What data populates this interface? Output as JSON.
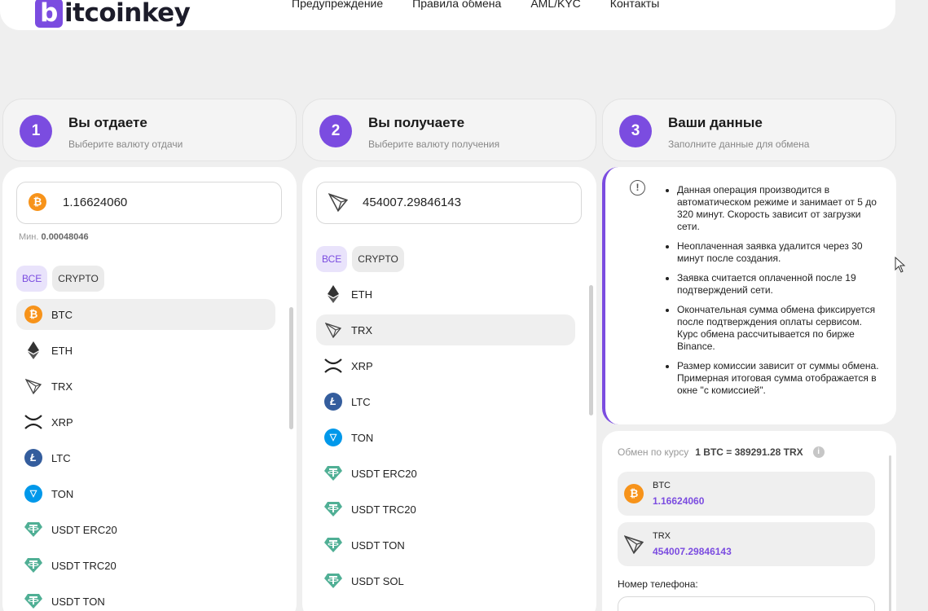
{
  "brand": {
    "logo_letter": "b",
    "logo_rest": "itcoinkey"
  },
  "nav": [
    {
      "label": "Предупреждение"
    },
    {
      "label": "Правила обмена"
    },
    {
      "label": "AML/KYC"
    },
    {
      "label": "Контакты"
    }
  ],
  "steps": [
    {
      "num": "1",
      "title": "Вы отдаете",
      "sub": "Выберите валюту отдачи"
    },
    {
      "num": "2",
      "title": "Вы получаете",
      "sub": "Выберите валюту получения"
    },
    {
      "num": "3",
      "title": "Ваши данные",
      "sub": "Заполните данные для обмена"
    }
  ],
  "give": {
    "amount": "1.16624060",
    "min_label": "Мин.",
    "min_value": "0.00048046",
    "filters": [
      "ВСЕ",
      "CRYPTO"
    ],
    "currencies": [
      {
        "label": "BTC",
        "icon": "bitcoin-icon",
        "selected": true
      },
      {
        "label": "ETH",
        "icon": "ethereum-icon"
      },
      {
        "label": "TRX",
        "icon": "tron-icon"
      },
      {
        "label": "XRP",
        "icon": "xrp-icon"
      },
      {
        "label": "LTC",
        "icon": "litecoin-icon"
      },
      {
        "label": "TON",
        "icon": "ton-icon"
      },
      {
        "label": "USDT ERC20",
        "icon": "tether-icon"
      },
      {
        "label": "USDT TRC20",
        "icon": "tether-icon"
      },
      {
        "label": "USDT TON",
        "icon": "tether-icon"
      }
    ]
  },
  "receive": {
    "amount": "454007.29846143",
    "filters": [
      "ВСЕ",
      "CRYPTO"
    ],
    "currencies": [
      {
        "label": "ETH",
        "icon": "ethereum-icon"
      },
      {
        "label": "TRX",
        "icon": "tron-icon",
        "selected": true
      },
      {
        "label": "XRP",
        "icon": "xrp-icon"
      },
      {
        "label": "LTC",
        "icon": "litecoin-icon"
      },
      {
        "label": "TON",
        "icon": "ton-icon"
      },
      {
        "label": "USDT ERC20",
        "icon": "tether-icon"
      },
      {
        "label": "USDT TRC20",
        "icon": "tether-icon"
      },
      {
        "label": "USDT TON",
        "icon": "tether-icon"
      },
      {
        "label": "USDT SOL",
        "icon": "tether-icon"
      }
    ]
  },
  "info": {
    "notes": [
      "Данная операция производится в автоматическом режиме и занимает от 5 до 320 минут. Скорость зависит от загрузки сети.",
      "Неоплаченная заявка удалится через 30 минут после создания.",
      "Заявка считается оплаченной после 19 подтверждений сети.",
      "Окончательная сумма обмена фиксируется после подтверждения оплаты сервисом. Курс обмена рассчитывается по бирже Binance.",
      "Размер комиссии зависит от суммы обмена. Примерная итоговая сумма отображается в окне \"с комиссией\"."
    ]
  },
  "summary": {
    "rate_label": "Обмен по курсу",
    "rate_value": "1 BTC = 389291.28 TRX",
    "give": {
      "currency": "BTC",
      "amount": "1.16624060"
    },
    "receive": {
      "currency": "TRX",
      "amount": "454007.29846143"
    },
    "phone_label": "Номер телефона:"
  },
  "colors": {
    "accent": "#7b4ce0",
    "btc": "#f7931a",
    "ltc": "#345d9d",
    "ton": "#0098ea",
    "tether": "#50af95"
  }
}
